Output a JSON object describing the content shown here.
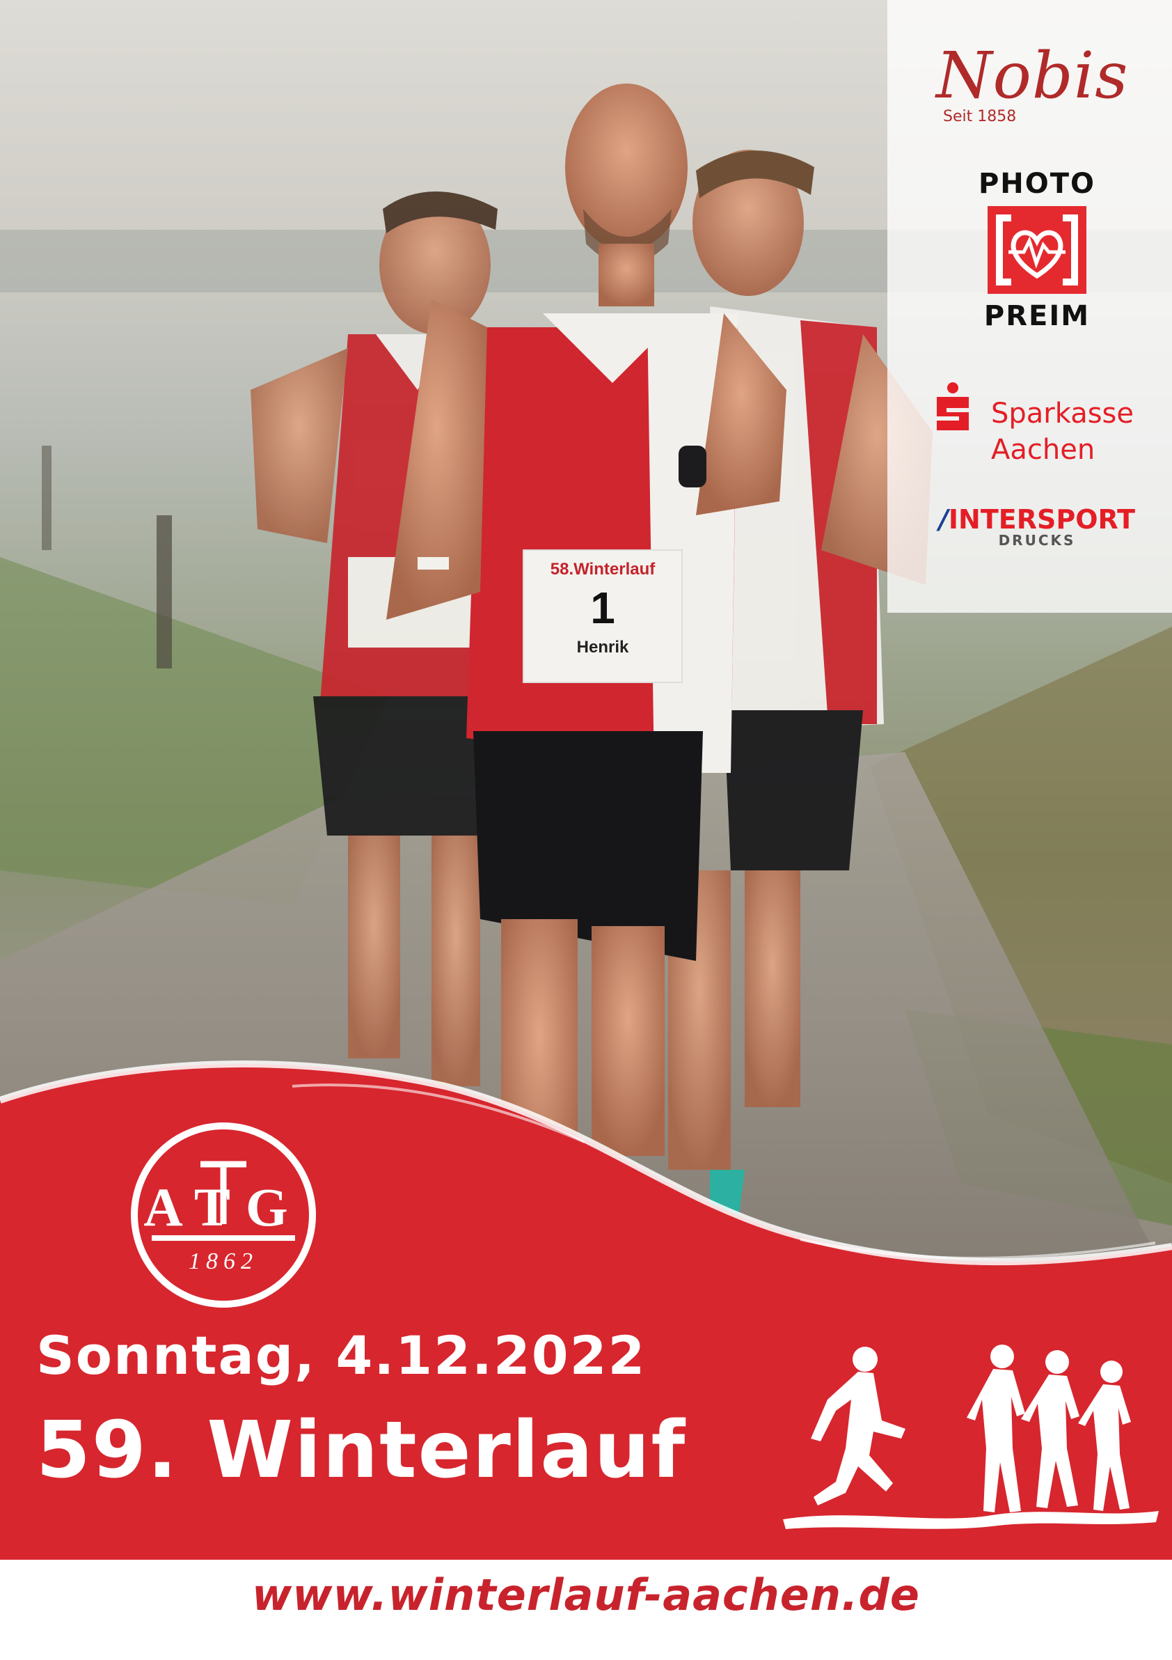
{
  "sponsors": {
    "nobis": {
      "name": "Nobis",
      "since": "Seit 1858"
    },
    "photo_preim": {
      "line1": "PHOTO",
      "line2": "PREIM"
    },
    "sparkasse": {
      "line1": "Sparkasse",
      "line2": "Aachen"
    },
    "intersport": {
      "name": "INTERSPORT",
      "sub": "DRUCKS"
    }
  },
  "club_logo": {
    "letters": "ATG",
    "year": "1862"
  },
  "race_bibs": {
    "event_name": "58.Winterlauf",
    "bib_number": "1",
    "bib_name": "Henrik"
  },
  "event": {
    "date": "Sonntag, 4.12.2022",
    "title": "59. Winterlauf",
    "url": "www.winterlauf-aachen.de"
  },
  "colors": {
    "brand_red": "#d7262e",
    "url_red": "#c8232c",
    "white": "#ffffff",
    "intersport_blue": "#1c3f94"
  }
}
